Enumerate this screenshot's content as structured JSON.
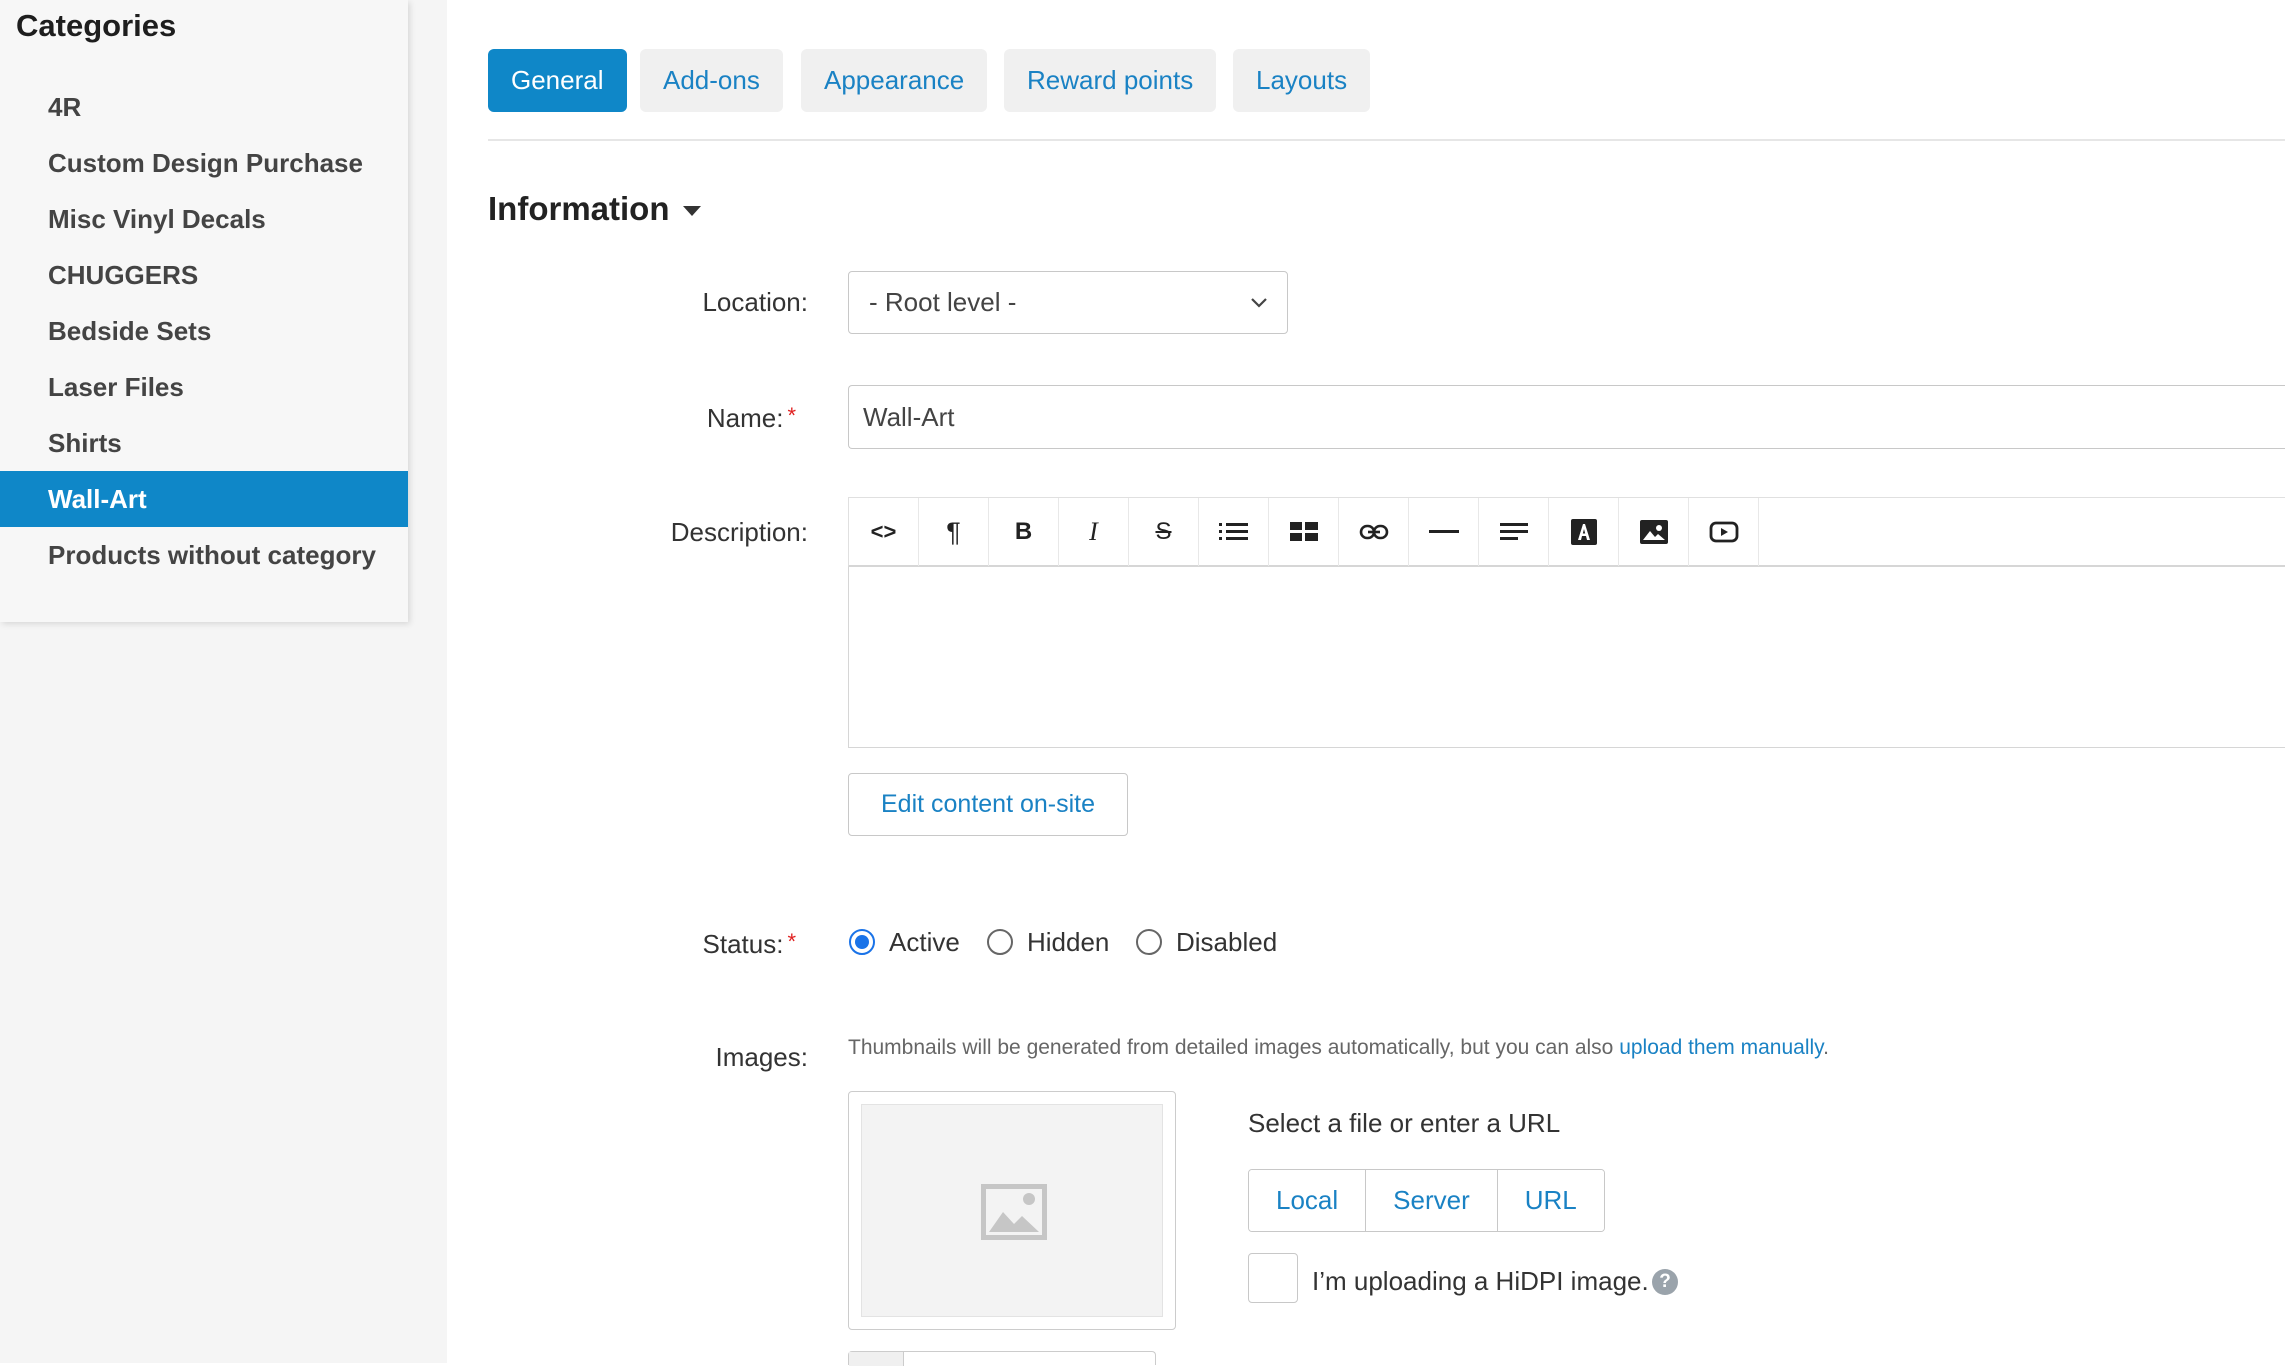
{
  "sidebar": {
    "title": "Categories",
    "items": [
      {
        "label": "4R"
      },
      {
        "label": "Custom Design Purchase"
      },
      {
        "label": "Misc Vinyl Decals"
      },
      {
        "label": "CHUGGERS"
      },
      {
        "label": "Bedside Sets"
      },
      {
        "label": "Laser Files"
      },
      {
        "label": "Shirts"
      },
      {
        "label": "Wall-Art",
        "active": true
      },
      {
        "label": "Products without category"
      }
    ]
  },
  "tabs": [
    {
      "label": "General",
      "active": true
    },
    {
      "label": "Add-ons"
    },
    {
      "label": "Appearance"
    },
    {
      "label": "Reward points"
    },
    {
      "label": "Layouts"
    }
  ],
  "section": {
    "title": "Information"
  },
  "form": {
    "location": {
      "label": "Location:",
      "value": "- Root level -"
    },
    "name": {
      "label": "Name:",
      "value": "Wall-Art",
      "required_mark": "*"
    },
    "description": {
      "label": "Description:",
      "toolbar": [
        "code-view-icon",
        "paragraph-icon",
        "bold-icon",
        "italic-icon",
        "strikethrough-icon",
        "list-icon",
        "table-icon",
        "link-icon",
        "horizontal-rule-icon",
        "align-icon",
        "font-color-icon",
        "image-icon",
        "video-icon"
      ],
      "bold_glyph": "B",
      "italic_glyph": "I",
      "paragraph_glyph": "¶",
      "code_glyph": "<>",
      "strike_glyph": "S"
    },
    "edit_onsite_label": "Edit content on-site",
    "status": {
      "label": "Status:",
      "required_mark": "*",
      "options": [
        {
          "label": "Active",
          "checked": true
        },
        {
          "label": "Hidden"
        },
        {
          "label": "Disabled"
        }
      ]
    },
    "images": {
      "label": "Images:",
      "hint_text": "Thumbnails will be generated from detailed images automatically, but you can also ",
      "hint_link": "upload them manually",
      "hint_end": ".",
      "select_label": "Select a file or enter a URL",
      "sources": [
        {
          "label": "Local"
        },
        {
          "label": "Server"
        },
        {
          "label": "URL"
        }
      ],
      "hidpi_label": "I’m uploading a HiDPI image.",
      "help_glyph": "?"
    }
  },
  "colors": {
    "accent": "#0f87c8",
    "link": "#1a82c4",
    "required": "#e02020",
    "radio": "#1a73e8"
  }
}
